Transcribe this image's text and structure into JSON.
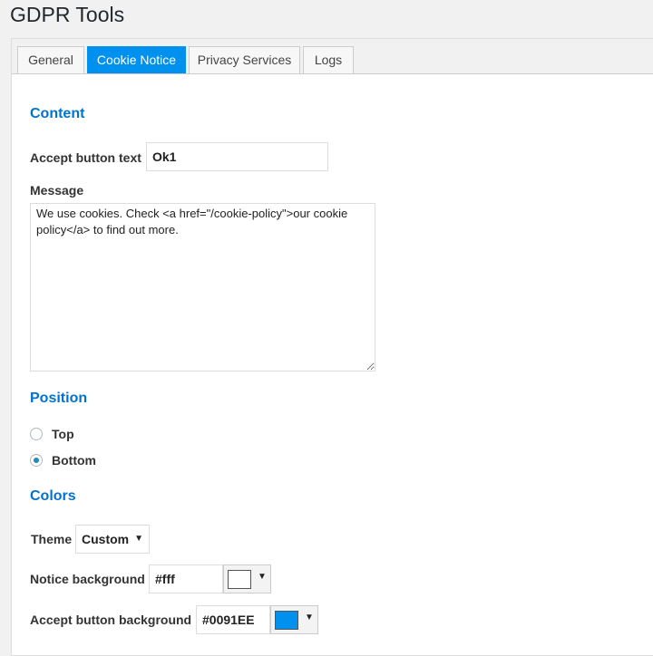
{
  "page": {
    "title": "GDPR Tools"
  },
  "tabs": [
    {
      "label": "General",
      "active": false
    },
    {
      "label": "Cookie Notice",
      "active": true
    },
    {
      "label": "Privacy Services",
      "active": false
    },
    {
      "label": "Logs",
      "active": false
    }
  ],
  "content": {
    "heading": "Content",
    "accept_button_label": "Accept button text",
    "accept_button_value": "Ok1",
    "message_label": "Message",
    "message_value": "We use cookies. Check <a href=\"/cookie-policy\">our cookie policy</a> to find out more."
  },
  "position": {
    "heading": "Position",
    "options": [
      {
        "label": "Top",
        "checked": false
      },
      {
        "label": "Bottom",
        "checked": true
      }
    ]
  },
  "colors": {
    "heading": "Colors",
    "theme_label": "Theme",
    "theme_value": "Custom",
    "notice_bg_label": "Notice background",
    "notice_bg_value": "#fff",
    "accept_bg_label": "Accept button background",
    "accept_bg_value": "#0091EE"
  },
  "style": {
    "accent": "#0091EE",
    "heading_color": "#0073cf",
    "icons": [
      "dropdown-caret-icon",
      "radio-icon"
    ]
  }
}
